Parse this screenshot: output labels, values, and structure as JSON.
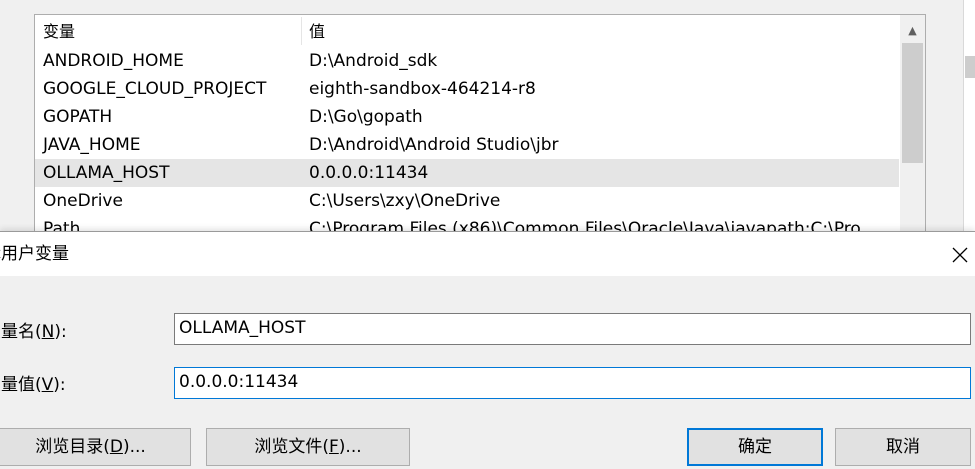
{
  "env_list": {
    "columns": {
      "name": "变量",
      "value": "值"
    },
    "rows": [
      {
        "name": "ANDROID_HOME",
        "value": "D:\\Android_sdk"
      },
      {
        "name": "GOOGLE_CLOUD_PROJECT",
        "value": "eighth-sandbox-464214-r8"
      },
      {
        "name": "GOPATH",
        "value": "D:\\Go\\gopath"
      },
      {
        "name": "JAVA_HOME",
        "value": "D:\\Android\\Android Studio\\jbr"
      },
      {
        "name": "OLLAMA_HOST",
        "value": "0.0.0.0:11434"
      },
      {
        "name": "OneDrive",
        "value": "C:\\Users\\zxy\\OneDrive"
      },
      {
        "name": "Path",
        "value": "C:\\Program Files (x86)\\Common Files\\Oracle\\Java\\javapath;C:\\Pro..."
      }
    ],
    "selected_row": "OLLAMA_HOST"
  },
  "dialog": {
    "title": "辑用户变量",
    "name_label": {
      "text": "变量名(",
      "key": "N",
      "suffix": "):"
    },
    "value_label": {
      "text": "变量值(",
      "key": "V",
      "suffix": "):"
    },
    "name_value": "OLLAMA_HOST",
    "value_value": "0.0.0.0:11434",
    "browse_dir": {
      "text": "浏览目录(",
      "key": "D",
      "suffix": ")..."
    },
    "browse_file": {
      "text": "浏览文件(",
      "key": "F",
      "suffix": ")..."
    },
    "ok_label": "确定",
    "cancel_label": "取消",
    "close_icon": "close-icon"
  }
}
